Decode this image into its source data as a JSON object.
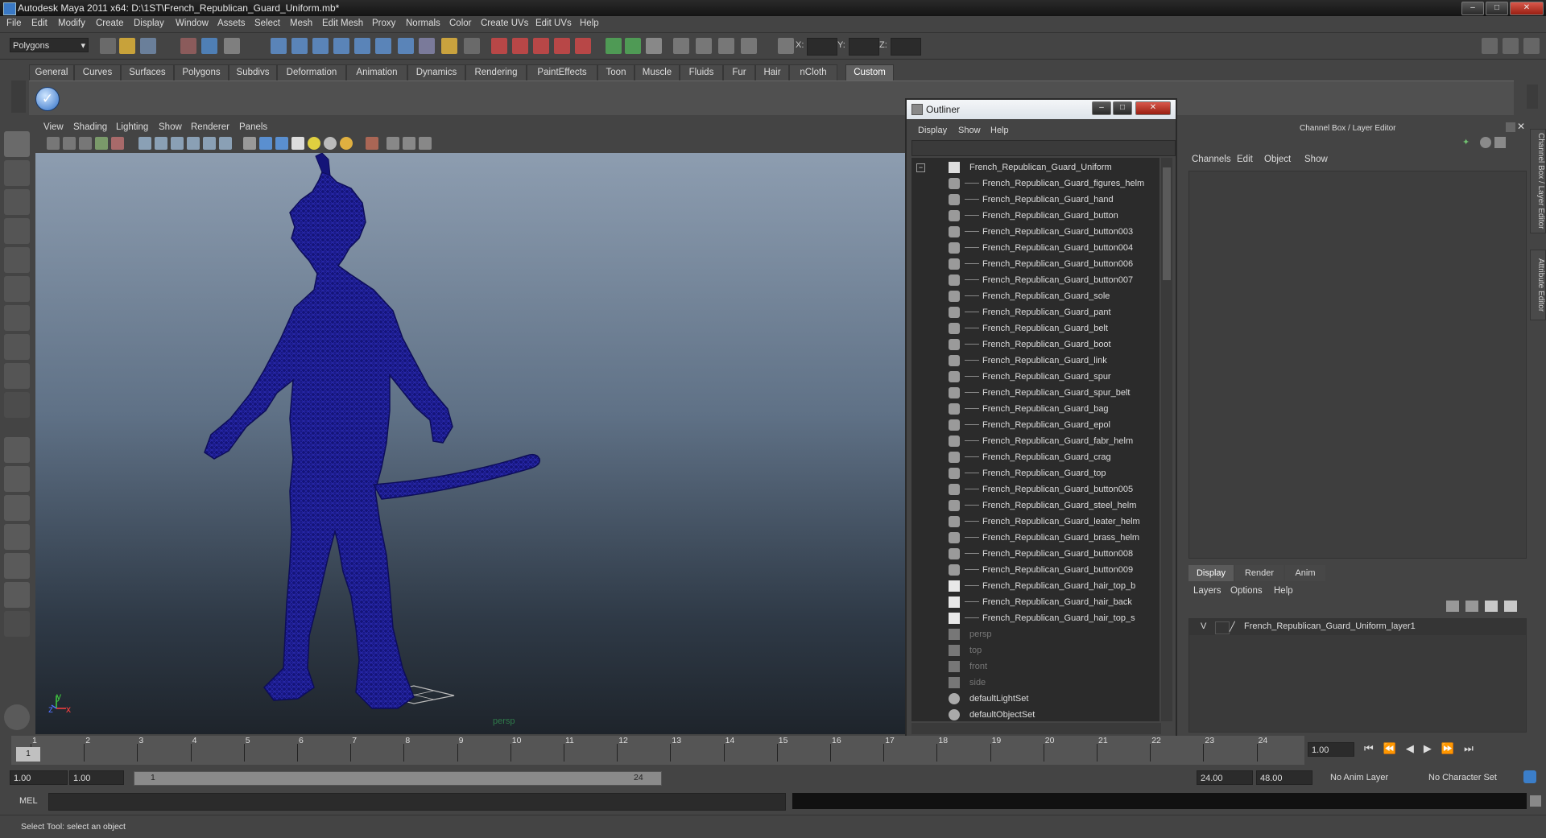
{
  "window": {
    "title": "Autodesk Maya 2011 x64: D:\\1ST\\French_Republican_Guard_Uniform.mb*",
    "minimize": "–",
    "maximize": "□",
    "close": "✕"
  },
  "menubar": [
    "File",
    "Edit",
    "Modify",
    "Create",
    "Display",
    "Window",
    "Assets",
    "Select",
    "Mesh",
    "Edit Mesh",
    "Proxy",
    "Normals",
    "Color",
    "Create UVs",
    "Edit UVs",
    "Help"
  ],
  "statusline": {
    "mode": "Polygons",
    "x_label": "X:",
    "y_label": "Y:",
    "z_label": "Z:"
  },
  "shelf": {
    "tabs": [
      "General",
      "Curves",
      "Surfaces",
      "Polygons",
      "Subdivs",
      "Deformation",
      "Animation",
      "Dynamics",
      "Rendering",
      "PaintEffects",
      "Toon",
      "Muscle",
      "Fluids",
      "Fur",
      "Hair",
      "nCloth",
      "Custom"
    ],
    "active_tab": "Custom"
  },
  "viewport": {
    "menu": [
      "View",
      "Shading",
      "Lighting",
      "Show",
      "Renderer",
      "Panels"
    ],
    "camera_label": "persp",
    "axis_y": "y",
    "axis_z": "z",
    "axis_x": "x",
    "wire_color": "#1a1a8c"
  },
  "outliner": {
    "title": "Outliner",
    "menu": [
      "Display",
      "Show",
      "Help"
    ],
    "root": "French_Republican_Guard_Uniform",
    "children": [
      {
        "label": "French_Republican_Guard_figures_helm",
        "icon": "mesh-icon"
      },
      {
        "label": "French_Republican_Guard_hand",
        "icon": "mesh-icon"
      },
      {
        "label": "French_Republican_Guard_button",
        "icon": "mesh-icon"
      },
      {
        "label": "French_Republican_Guard_button003",
        "icon": "mesh-icon"
      },
      {
        "label": "French_Republican_Guard_button004",
        "icon": "mesh-icon"
      },
      {
        "label": "French_Republican_Guard_button006",
        "icon": "mesh-icon"
      },
      {
        "label": "French_Republican_Guard_button007",
        "icon": "mesh-icon"
      },
      {
        "label": "French_Republican_Guard_sole",
        "icon": "mesh-icon"
      },
      {
        "label": "French_Republican_Guard_pant",
        "icon": "mesh-icon"
      },
      {
        "label": "French_Republican_Guard_belt",
        "icon": "mesh-icon"
      },
      {
        "label": "French_Republican_Guard_boot",
        "icon": "mesh-icon"
      },
      {
        "label": "French_Republican_Guard_link",
        "icon": "mesh-icon"
      },
      {
        "label": "French_Republican_Guard_spur",
        "icon": "mesh-icon"
      },
      {
        "label": "French_Republican_Guard_spur_belt",
        "icon": "mesh-icon"
      },
      {
        "label": "French_Republican_Guard_bag",
        "icon": "mesh-icon"
      },
      {
        "label": "French_Republican_Guard_epol",
        "icon": "mesh-icon"
      },
      {
        "label": "French_Republican_Guard_fabr_helm",
        "icon": "mesh-icon"
      },
      {
        "label": "French_Republican_Guard_crag",
        "icon": "mesh-icon"
      },
      {
        "label": "French_Republican_Guard_top",
        "icon": "mesh-icon"
      },
      {
        "label": "French_Republican_Guard_button005",
        "icon": "mesh-icon"
      },
      {
        "label": "French_Republican_Guard_steel_helm",
        "icon": "mesh-icon"
      },
      {
        "label": "French_Republican_Guard_leater_helm",
        "icon": "mesh-icon"
      },
      {
        "label": "French_Republican_Guard_brass_helm",
        "icon": "mesh-icon"
      },
      {
        "label": "French_Republican_Guard_button008",
        "icon": "mesh-icon"
      },
      {
        "label": "French_Republican_Guard_button009",
        "icon": "mesh-icon"
      },
      {
        "label": "French_Republican_Guard_hair_top_b",
        "icon": "curve-icon"
      },
      {
        "label": "French_Republican_Guard_hair_back",
        "icon": "curve-icon"
      },
      {
        "label": "French_Republican_Guard_hair_top_s",
        "icon": "curve-icon"
      }
    ],
    "cameras": [
      "persp",
      "top",
      "front",
      "side"
    ],
    "sets": [
      "defaultLightSet",
      "defaultObjectSet"
    ]
  },
  "channelbox": {
    "title": "Channel Box / Layer Editor",
    "menu": [
      "Channels",
      "Edit",
      "Object",
      "Show"
    ],
    "layer_tabs": [
      "Display",
      "Render",
      "Anim"
    ],
    "active_layer_tab": "Display",
    "layer_menu": [
      "Layers",
      "Options",
      "Help"
    ],
    "layer": {
      "visible": "V",
      "name": "French_Republican_Guard_Uniform_layer1"
    },
    "side_tabs": [
      "Channel Box / Layer Editor",
      "Attribute Editor"
    ]
  },
  "timeline": {
    "ticks": [
      1,
      2,
      3,
      4,
      5,
      6,
      7,
      8,
      9,
      10,
      11,
      12,
      13,
      14,
      15,
      16,
      17,
      18,
      19,
      20,
      21,
      22,
      23,
      24
    ],
    "current_frame_label": "1",
    "current_time": "1.00"
  },
  "range": {
    "start": "1.00",
    "playback_start": "1.00",
    "range_start_label": "1",
    "range_end_label": "24",
    "playback_end": "24.00",
    "end": "48.00",
    "anim_layer": "No Anim Layer",
    "character_set": "No Character Set"
  },
  "mel": {
    "label": "MEL"
  },
  "helpline": {
    "text": "Select Tool: select an object"
  }
}
